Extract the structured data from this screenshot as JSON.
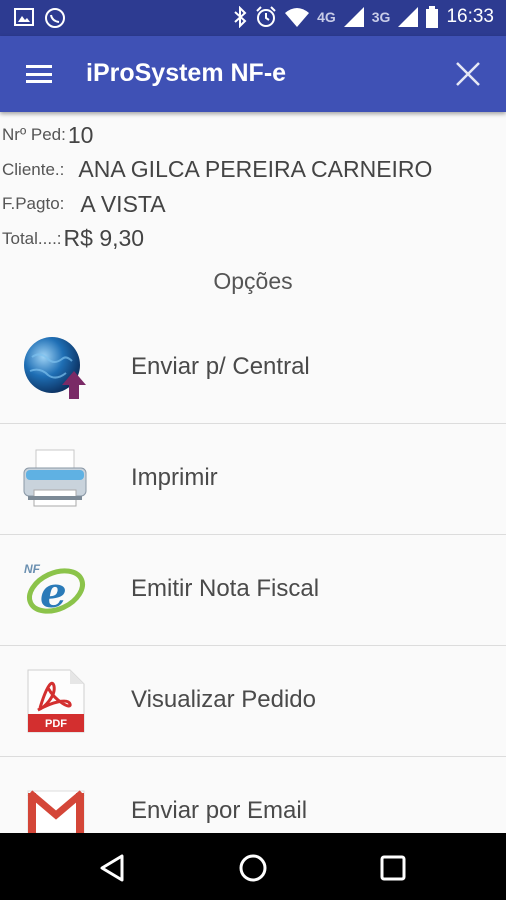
{
  "status_bar": {
    "time": "16:33",
    "net_1": "4G",
    "net_2": "3G",
    "icons": [
      "image-icon",
      "whatsapp-icon",
      "bluetooth-icon",
      "alarm-icon",
      "wifi-icon",
      "signal-icon",
      "signal-icon",
      "battery-icon"
    ]
  },
  "app_bar": {
    "title": "iProSystem NF-e"
  },
  "order": {
    "number_label": "Nrº Ped:",
    "number_value": "10",
    "client_label": "Cliente.:",
    "client_value": "ANA GILCA PEREIRA CARNEIRO",
    "payment_label": "F.Pagto:",
    "payment_value": "A VISTA",
    "total_label": "Total....:",
    "total_value": "R$ 9,30"
  },
  "options_title": "Opções",
  "options": [
    {
      "label": "Enviar p/ Central",
      "icon": "globe-upload-icon"
    },
    {
      "label": "Imprimir",
      "icon": "printer-icon"
    },
    {
      "label": "Emitir Nota Fiscal",
      "icon": "nfe-icon"
    },
    {
      "label": "Visualizar Pedido",
      "icon": "pdf-icon",
      "icon_text": "PDF"
    },
    {
      "label": "Enviar por Email",
      "icon": "gmail-icon"
    }
  ],
  "nav": {
    "icons": [
      "back-icon",
      "home-icon",
      "recents-icon"
    ]
  },
  "colors": {
    "status_bar": "#2d3b91",
    "app_bar": "#3f51b5",
    "background": "#fafafa"
  }
}
